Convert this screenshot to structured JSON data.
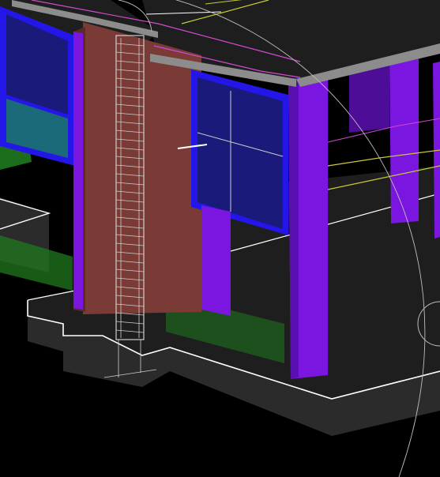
{
  "viewport": {
    "kind": "3d-model-viewport",
    "background": "#000000",
    "colors": {
      "slab_top": "#1e1e1e",
      "slab_side": "#2b2b2b",
      "slab_edge": "#ffffff",
      "column": "#7a16e0",
      "column_dark": "#5a0fb0",
      "wall": "#7a3a36",
      "wall_dark": "#5c2a28",
      "window_frame": "#2416e8",
      "window_glass": "#1a1a7a",
      "glass_teal": "#1a6a7a",
      "green": "#1f7a1f",
      "rebar": "#cfcfcf",
      "beam": "#8c8c8c",
      "magenta_line": "#d14ad1",
      "yellow_line": "#c9c93a",
      "guide_arc": "#bdbdbd"
    }
  }
}
